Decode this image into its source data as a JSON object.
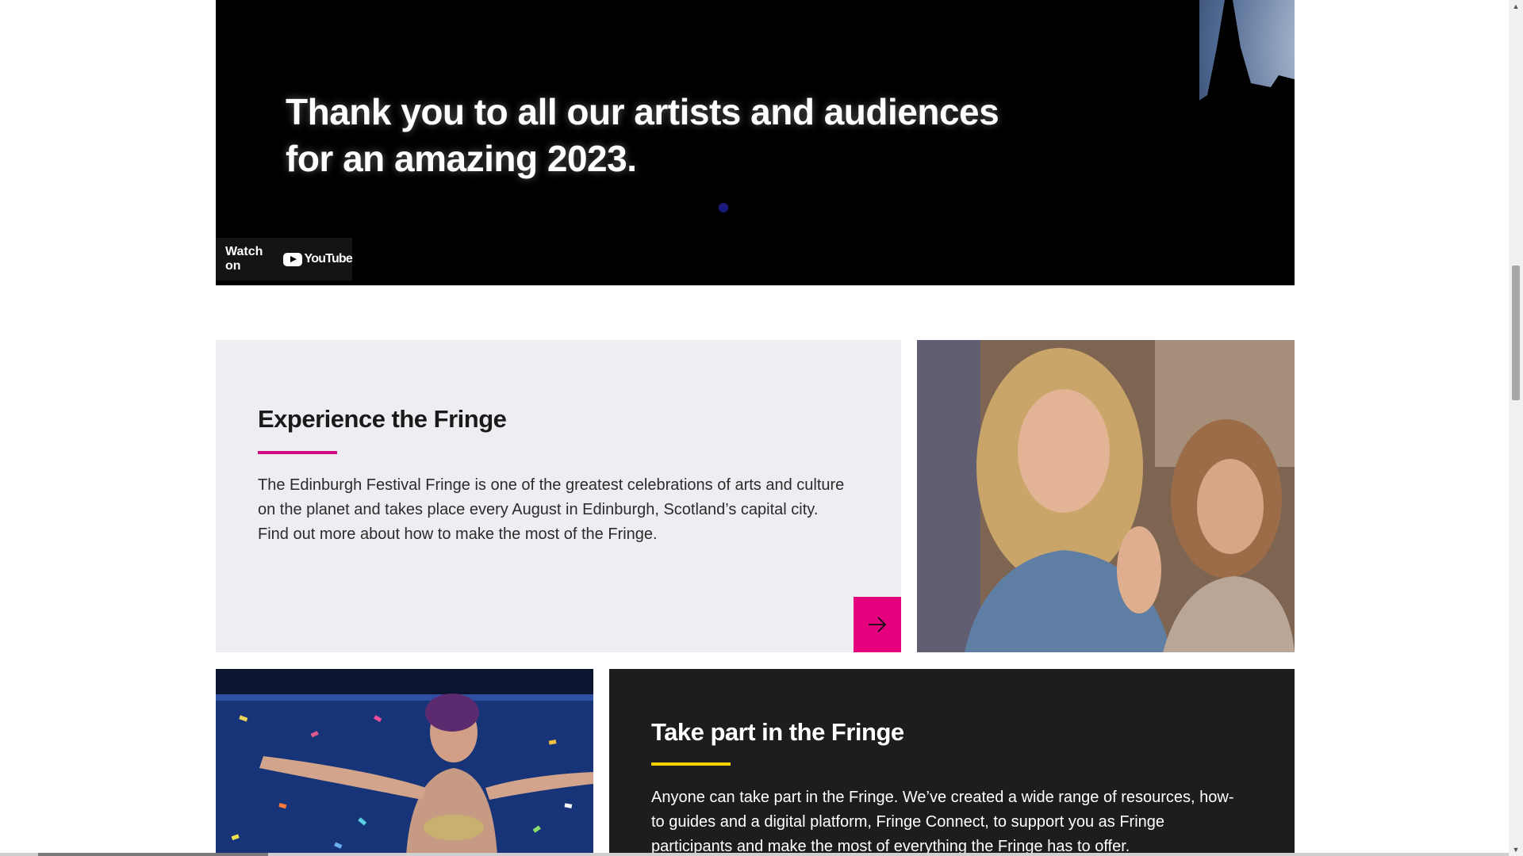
{
  "video": {
    "caption_line1": "Thank you to all our artists and audiences",
    "caption_line2": "for an amazing 2023.",
    "watch_on_label": "Watch on",
    "youtube_label": "YouTube"
  },
  "experience": {
    "title": "Experience the Fringe",
    "body": "The Edinburgh Festival Fringe is one of the greatest celebrations of arts and culture on the planet and takes place every August in Edinburgh, Scotland’s capital city. Find out more about how to make the most of the Fringe.",
    "accent_color": "#d10a83",
    "button_icon": "arrow-right-icon"
  },
  "take_part": {
    "title": "Take part in the Fringe",
    "body": "Anyone can take part in the Fringe. We’ve created a wide range of resources, how-to guides and a digital platform, Fringe Connect, to support you as Fringe participants and make the most of everything the Fringe has to offer.",
    "accent_color": "#f5d100"
  },
  "colors": {
    "brand_pink": "#e5007e",
    "card_light": "#eceef2",
    "card_dark": "#1d1d1d"
  }
}
